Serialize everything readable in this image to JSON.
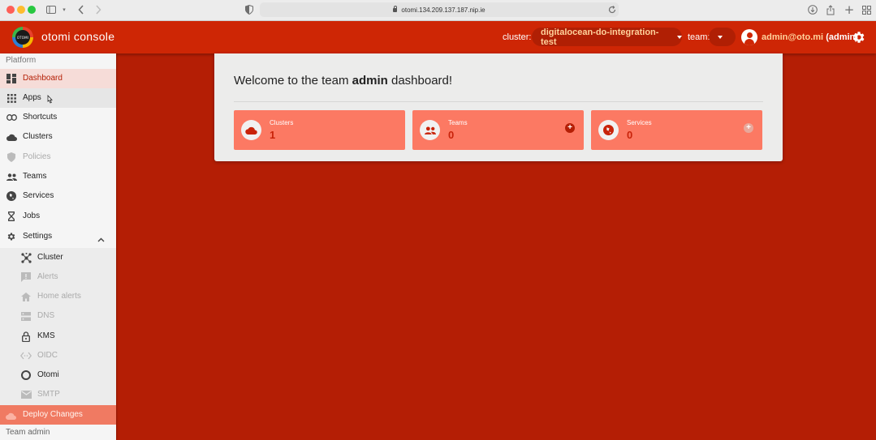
{
  "browser": {
    "url": "otomi.134.209.137.187.nip.ie"
  },
  "header": {
    "logo_text": "OTOMI",
    "brand": "otomi console",
    "cluster_label": "cluster:",
    "cluster_value": "digitalocean-do-integration-test",
    "team_label": "team:",
    "user_email": "admin@oto.mi",
    "user_role": "(admin)"
  },
  "sidebar": {
    "section_platform": "Platform",
    "items": [
      {
        "label": "Dashboard",
        "icon": "dashboard-icon"
      },
      {
        "label": "Apps",
        "icon": "apps-grid-icon"
      },
      {
        "label": "Shortcuts",
        "icon": "link-icon"
      },
      {
        "label": "Clusters",
        "icon": "cloud-icon"
      },
      {
        "label": "Policies",
        "icon": "shield-icon"
      },
      {
        "label": "Teams",
        "icon": "people-icon"
      },
      {
        "label": "Services",
        "icon": "globe-icon"
      },
      {
        "label": "Jobs",
        "icon": "hourglass-icon"
      },
      {
        "label": "Settings",
        "icon": "gear-icon"
      }
    ],
    "settings_sub": [
      {
        "label": "Cluster",
        "icon": "cluster-icon"
      },
      {
        "label": "Alerts",
        "icon": "alert-icon"
      },
      {
        "label": "Home alerts",
        "icon": "home-icon"
      },
      {
        "label": "DNS",
        "icon": "dns-icon"
      },
      {
        "label": "KMS",
        "icon": "lock-icon"
      },
      {
        "label": "OIDC",
        "icon": "code-icon"
      },
      {
        "label": "Otomi",
        "icon": "otomi-icon"
      },
      {
        "label": "SMTP",
        "icon": "mail-icon"
      }
    ],
    "deploy_label": "Deploy Changes",
    "team_section": "Team admin"
  },
  "main": {
    "welcome_prefix": "Welcome to the team ",
    "welcome_team": "admin",
    "welcome_suffix": " dashboard!",
    "tiles": [
      {
        "label": "Clusters",
        "value": "1"
      },
      {
        "label": "Teams",
        "value": "0"
      },
      {
        "label": "Services",
        "value": "0"
      }
    ]
  },
  "colors": {
    "brand_red": "#ce2605",
    "background_red": "#b41e05",
    "tile_salmon": "#fc7963",
    "accent_text": "#ffd29c"
  }
}
